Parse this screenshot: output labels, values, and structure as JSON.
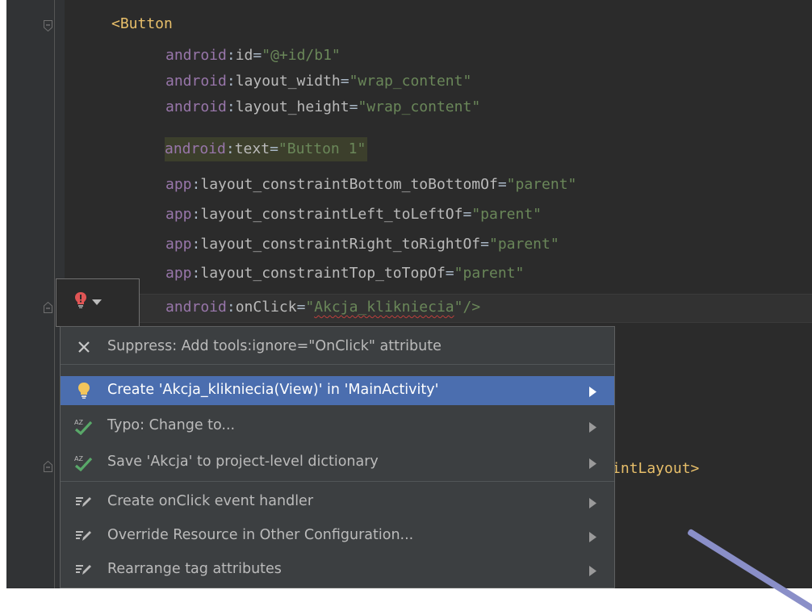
{
  "editor": {
    "code_lines": [
      {
        "tag": "<Button"
      },
      {
        "ns": "android",
        "attr": "id",
        "value": "\"@+id/b1\""
      },
      {
        "ns": "android",
        "attr": "layout_width",
        "value": "\"wrap_content\""
      },
      {
        "ns": "android",
        "attr": "layout_height",
        "value": "\"wrap_content\""
      },
      {
        "ns": "android",
        "attr": "text",
        "value": "\"Button 1\""
      },
      {
        "ns": "app",
        "attr": "layout_constraintBottom_toBottomOf",
        "value": "\"parent\""
      },
      {
        "ns": "app",
        "attr": "layout_constraintLeft_toLeftOf",
        "value": "\"parent\""
      },
      {
        "ns": "app",
        "attr": "layout_constraintRight_toRightOf",
        "value": "\"parent\""
      },
      {
        "ns": "app",
        "attr": "layout_constraintTop_toTopOf",
        "value": "\"parent\""
      },
      {
        "ns": "android",
        "attr": "onClick",
        "value_open": "\"",
        "value_typo": "Akcja_klikniecia",
        "value_close": "\"/>"
      }
    ],
    "partial_closing_tag": "intLayout>"
  },
  "intention_popup": {
    "items": [
      {
        "icon": "close-icon",
        "label": "Suppress: Add tools:ignore=\"OnClick\" attribute",
        "has_submenu": false
      },
      {
        "icon": "lightbulb-icon",
        "label": "Create 'Akcja_klikniecia(View)' in 'MainActivity'",
        "has_submenu": true,
        "selected": true
      },
      {
        "icon": "spellcheck-icon",
        "label": "Typo: Change to...",
        "has_submenu": true
      },
      {
        "icon": "spellcheck-icon",
        "label": "Save 'Akcja' to project-level dictionary",
        "has_submenu": true
      },
      {
        "icon": "edit-icon",
        "label": "Create onClick event handler",
        "has_submenu": true
      },
      {
        "icon": "edit-icon",
        "label": "Override Resource in Other Configuration...",
        "has_submenu": true
      },
      {
        "icon": "edit-icon",
        "label": "Rearrange tag attributes",
        "has_submenu": true
      }
    ]
  },
  "colors": {
    "editor_bg": "#2b2b2b",
    "tag": "#e8bf6a",
    "namespace": "#9876aa",
    "string": "#6a8759",
    "selection": "#4b6eaf",
    "error": "#e05555"
  }
}
